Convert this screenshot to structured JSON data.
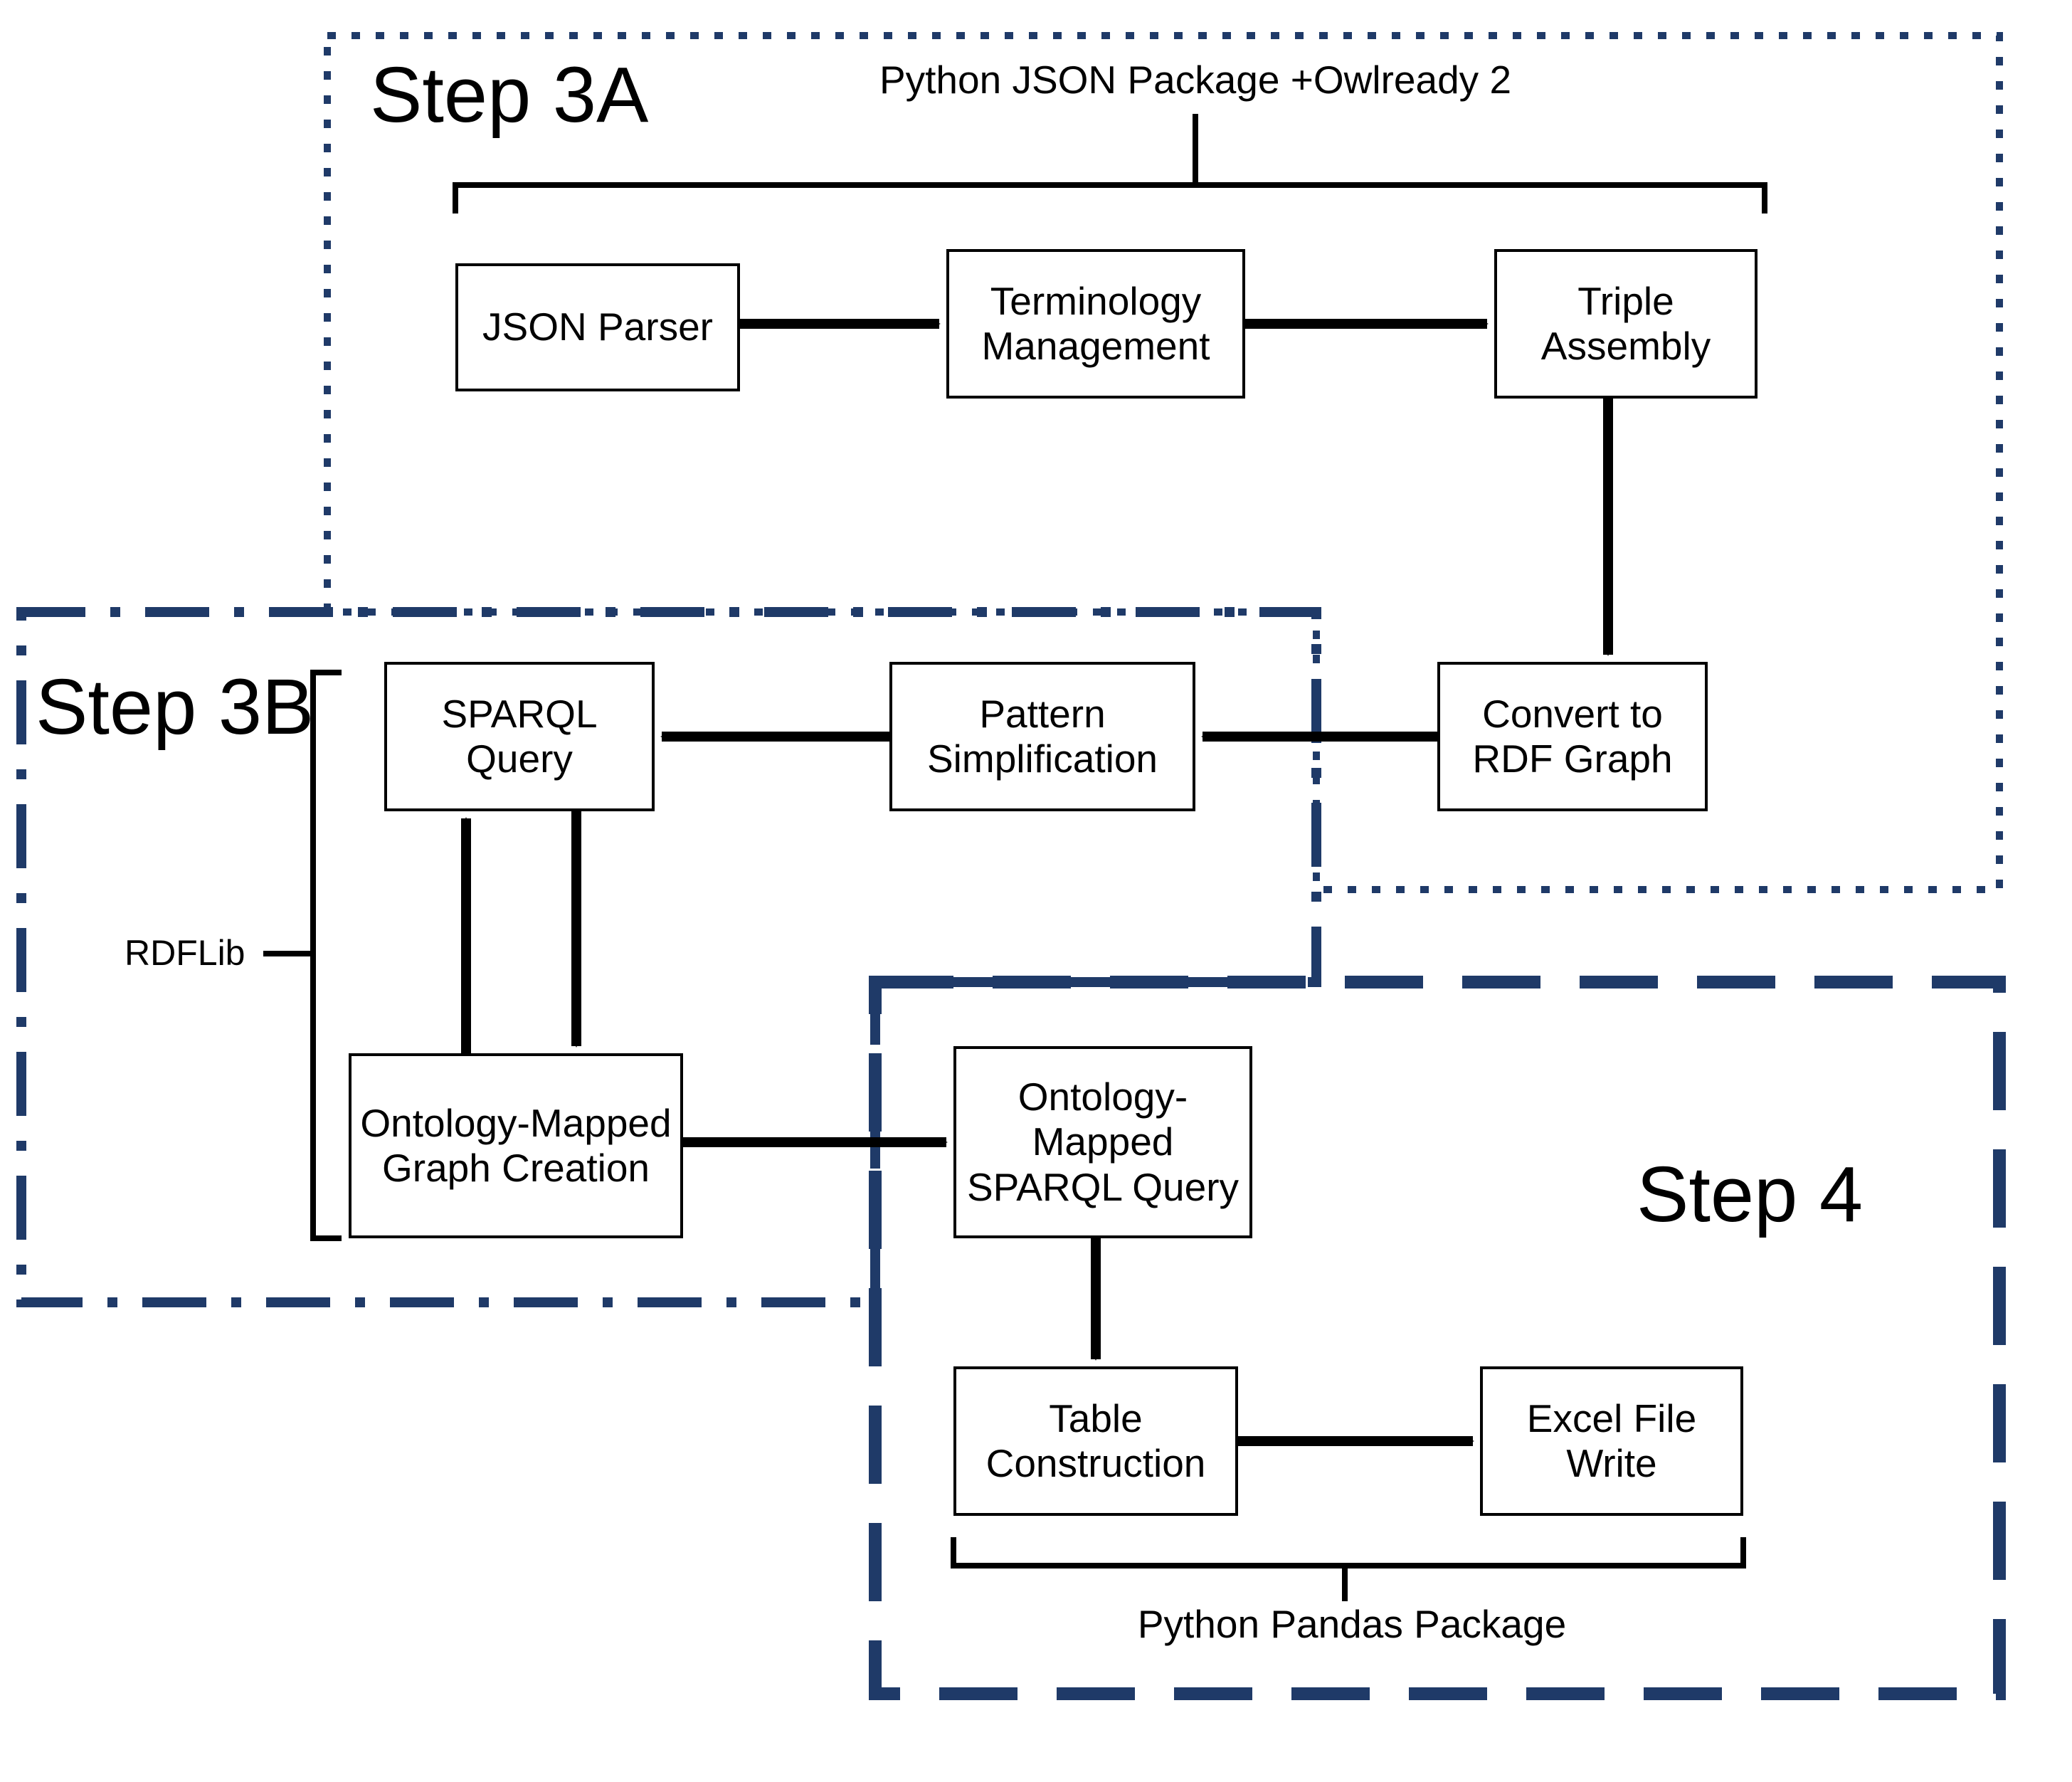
{
  "steps": {
    "a": "Step 3A",
    "b": "Step 3B",
    "c": "Step 4"
  },
  "labels": {
    "top_package": "Python JSON Package +Owlready 2",
    "rdflib": "RDFLib",
    "pandas": "Python Pandas Package"
  },
  "boxes": {
    "json_parser": "JSON Parser",
    "terminology": "Terminology Management",
    "triple_assembly": "Triple Assembly",
    "convert_rdf": "Convert to RDF Graph",
    "pattern_simpl": "Pattern Simplification",
    "sparql_query": "SPARQL Query",
    "onto_graph": "Ontology-Mapped Graph Creation",
    "onto_sparql": "Ontology-Mapped SPARQL Query",
    "table_constr": "Table Construction",
    "excel_write": "Excel File Write"
  },
  "colors": {
    "region_border": "#1f3a68",
    "arrow": "#000000"
  }
}
